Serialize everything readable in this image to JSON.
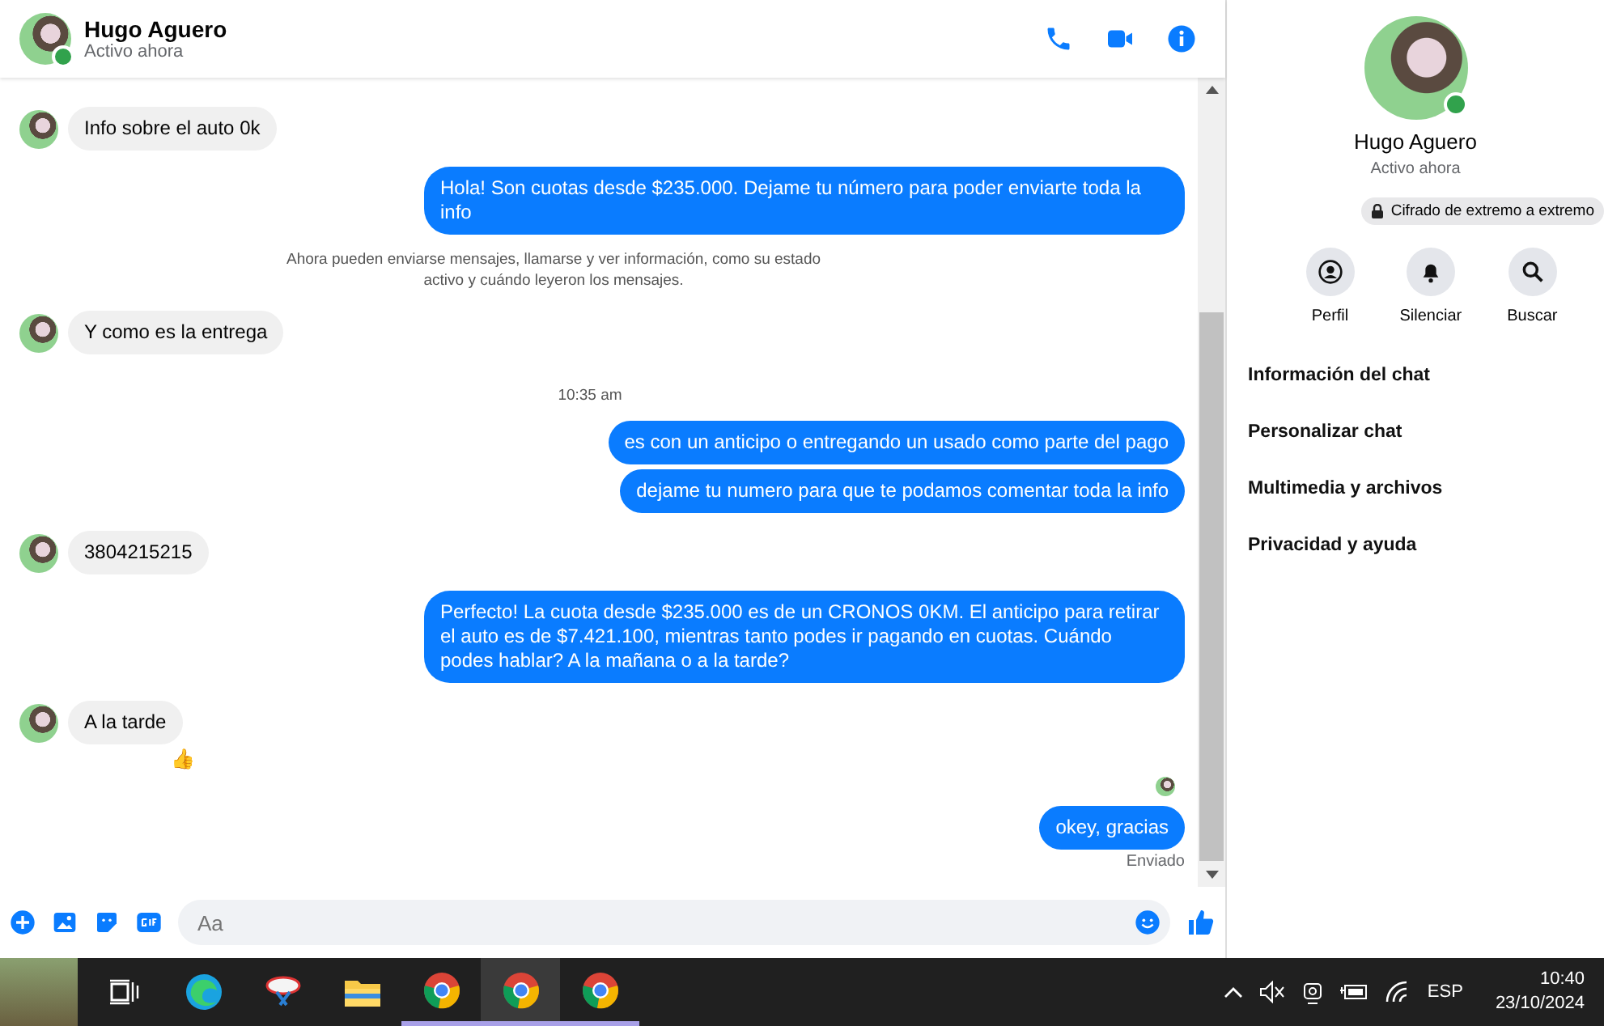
{
  "chat_header": {
    "name": "Hugo Aguero",
    "status": "Activo ahora",
    "online": true
  },
  "messages": [
    {
      "kind": "incoming",
      "text": "Info sobre el auto 0k"
    },
    {
      "kind": "outgoing",
      "text": "Hola! Son cuotas desde $235.000. Dejame tu número para poder enviarte toda la info"
    },
    {
      "kind": "system",
      "text": "Ahora pueden enviarse mensajes, llamarse y ver información, como su estado activo y cuándo leyeron los mensajes."
    },
    {
      "kind": "incoming",
      "text": "Y como es la entrega"
    },
    {
      "kind": "time",
      "text": "10:35 am"
    },
    {
      "kind": "outgoing",
      "text": "es con un anticipo o entregando un usado como parte del pago"
    },
    {
      "kind": "outgoing",
      "text": "dejame tu numero para que te podamos comentar toda la info"
    },
    {
      "kind": "incoming",
      "text": "3804215215"
    },
    {
      "kind": "outgoing",
      "text": "Perfecto! La cuota desde $235.000 es de un CRONOS 0KM. El anticipo para retirar el auto es de $7.421.100, mientras tanto podes ir pagando en cuotas. Cuándo podes hablar? A la mañana o a la tarde?"
    },
    {
      "kind": "incoming",
      "text": "A la tarde",
      "reaction": "👍"
    },
    {
      "kind": "seen"
    },
    {
      "kind": "outgoing",
      "text": "okey, gracias",
      "receipt": "Enviado"
    }
  ],
  "composer": {
    "placeholder": "Aa"
  },
  "info_panel": {
    "name": "Hugo Aguero",
    "status": "Activo ahora",
    "online": true,
    "encryption": "Cifrado de extremo a extremo",
    "actions": [
      {
        "kind": "profile",
        "label": "Perfil"
      },
      {
        "kind": "mute",
        "label": "Silenciar"
      },
      {
        "kind": "search",
        "label": "Buscar"
      }
    ],
    "sections": [
      "Información del chat",
      "Personalizar chat",
      "Multimedia y archivos",
      "Privacidad y ayuda"
    ]
  },
  "taskbar": {
    "apps": [
      {
        "kind": "taskview",
        "selected": false
      },
      {
        "kind": "edge",
        "selected": false
      },
      {
        "kind": "snip",
        "selected": false
      },
      {
        "kind": "folder",
        "selected": false
      },
      {
        "kind": "chrome",
        "selected": false
      },
      {
        "kind": "chrome",
        "selected": true
      },
      {
        "kind": "chrome",
        "selected": false
      }
    ],
    "language": "ESP",
    "time": "10:40",
    "date": "23/10/2024"
  }
}
